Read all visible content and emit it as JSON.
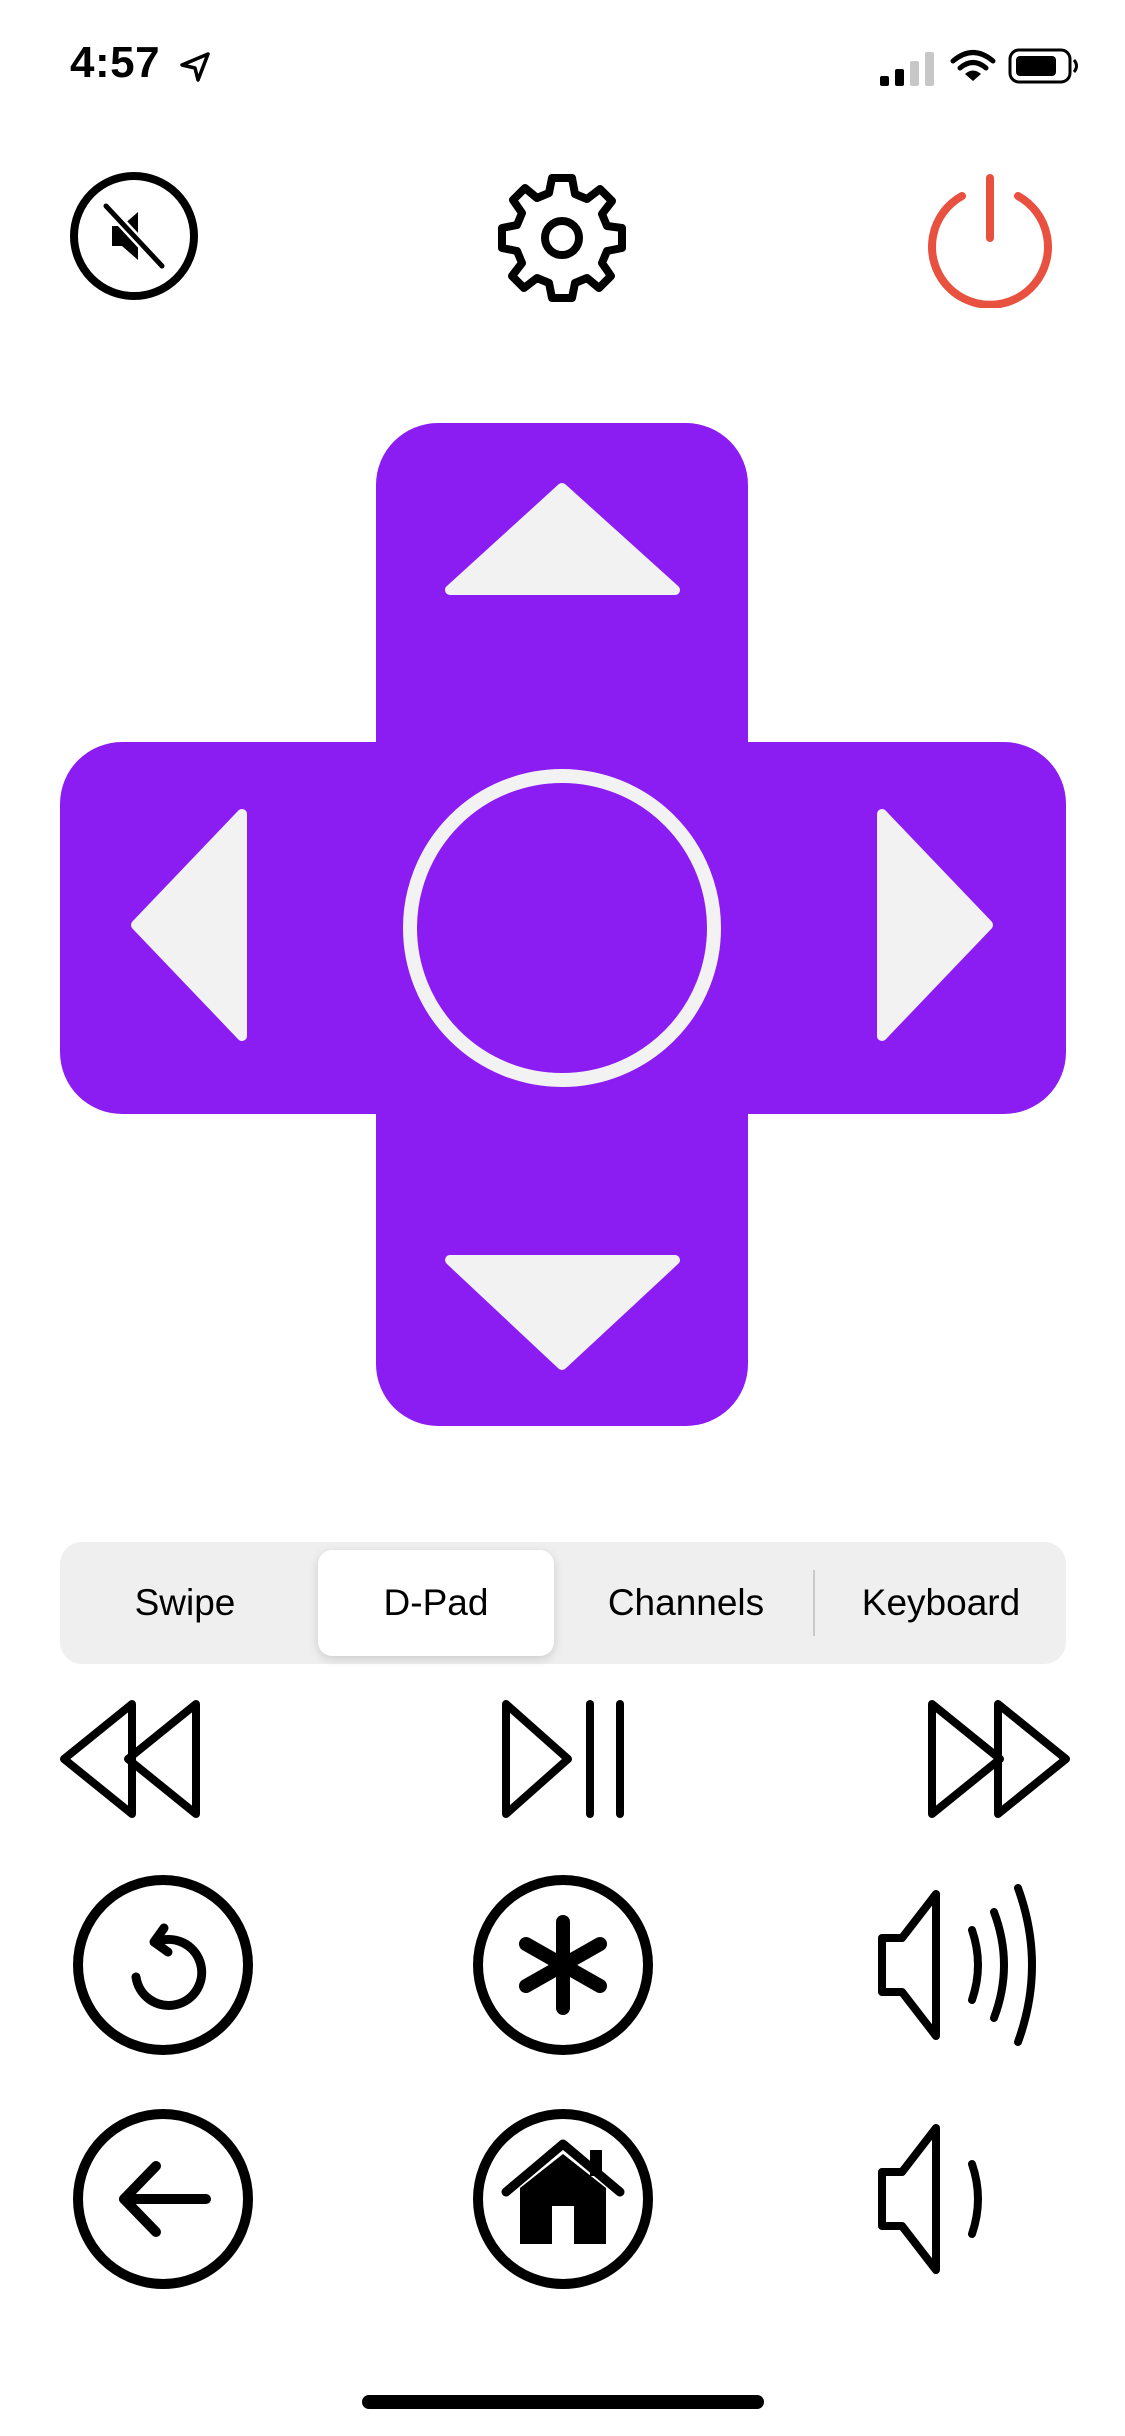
{
  "status_bar": {
    "time": "4:57",
    "icons": [
      "location-arrow-icon",
      "cellular-signal-icon",
      "wifi-icon",
      "battery-icon"
    ]
  },
  "top_controls": {
    "mute_icon": "speaker-muted-icon",
    "settings_icon": "gear-icon",
    "power_icon": "power-icon",
    "power_color": "#e8503f"
  },
  "dpad": {
    "color": "#8c1df2",
    "arrow_color": "#f2f2f2",
    "icons": [
      "up-arrow-icon",
      "down-arrow-icon",
      "left-arrow-icon",
      "right-arrow-icon",
      "ok-circle-icon"
    ]
  },
  "mode_selector": {
    "options": [
      "Swipe",
      "D-Pad",
      "Channels",
      "Keyboard"
    ],
    "selected": "D-Pad"
  },
  "media_controls": {
    "rows": [
      [
        "rewind-icon",
        "play-pause-icon",
        "fast-forward-icon"
      ],
      [
        "replay-icon",
        "options-star-icon",
        "volume-up-icon"
      ],
      [
        "back-icon",
        "home-icon",
        "volume-down-icon"
      ]
    ]
  }
}
